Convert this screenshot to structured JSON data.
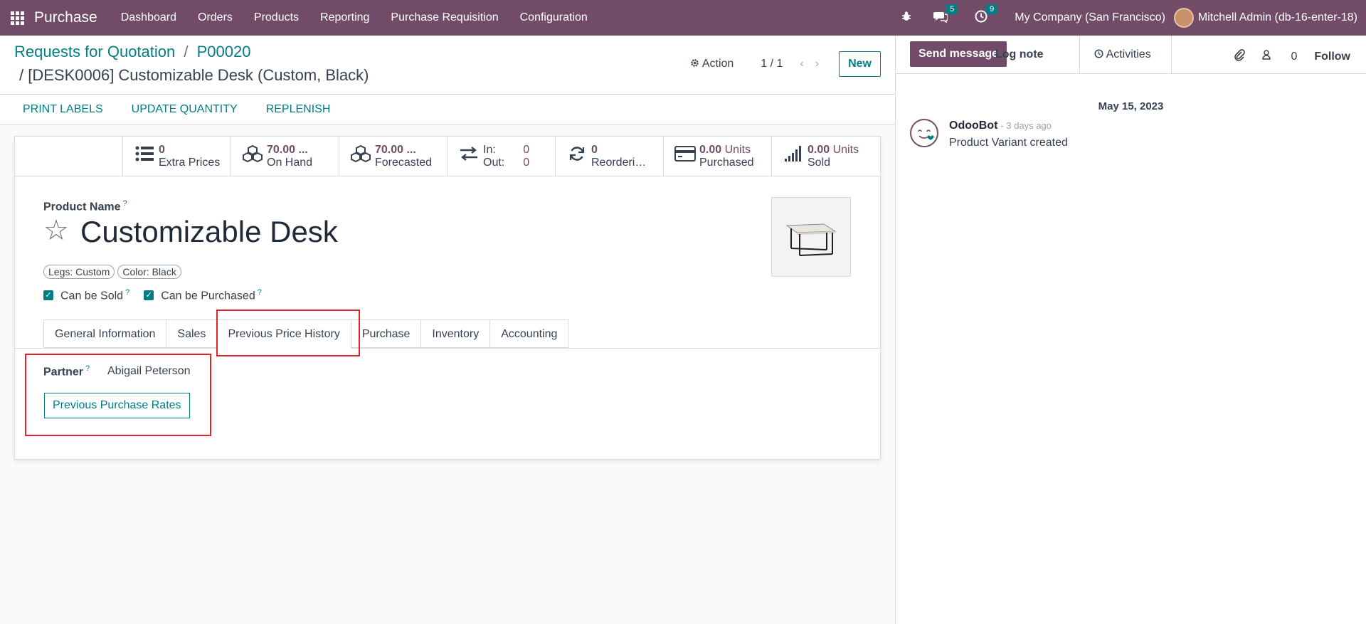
{
  "navbar": {
    "app_name": "Purchase",
    "menu": [
      "Dashboard",
      "Orders",
      "Products",
      "Reporting",
      "Purchase Requisition",
      "Configuration"
    ],
    "messages_count": "5",
    "activities_count": "9",
    "company": "My Company (San Francisco)",
    "user": "Mitchell Admin (db-16-enter-18)"
  },
  "breadcrumb": {
    "root": "Requests for Quotation",
    "separator": "/",
    "parent": "P00020",
    "current": "/ [DESK0006] Customizable Desk (Custom, Black)"
  },
  "control": {
    "action_label": "Action",
    "pager": "1 / 1",
    "new_label": "New"
  },
  "buttons": [
    "PRINT LABELS",
    "UPDATE QUANTITY",
    "REPLENISH"
  ],
  "stats": {
    "extra_prices": {
      "value": "0",
      "label": "Extra Prices"
    },
    "on_hand": {
      "value": "70.00 ...",
      "label": "On Hand"
    },
    "forecasted": {
      "value": "70.00 ...",
      "label": "Forecasted"
    },
    "in_label": "In:",
    "in_value": "0",
    "out_label": "Out:",
    "out_value": "0",
    "reordering": {
      "value": "0",
      "label": "Reorderi…"
    },
    "purchased": {
      "value": "0.00",
      "unit": "Units",
      "label": "Purchased"
    },
    "sold": {
      "value": "0.00",
      "unit": "Units",
      "label": "Sold"
    }
  },
  "product": {
    "name_label": "Product Name",
    "help": "?",
    "name": "Customizable Desk",
    "tags": [
      "Legs: Custom",
      "Color: Black"
    ],
    "can_be_sold": "Can be Sold",
    "can_be_purchased": "Can be Purchased"
  },
  "tabs": [
    "General Information",
    "Sales",
    "Previous Price History",
    "Purchase",
    "Inventory",
    "Accounting"
  ],
  "price_history": {
    "partner_label": "Partner",
    "partner_value": "Abigail Peterson",
    "button_label": "Previous Purchase Rates"
  },
  "chatter": {
    "send_message": "Send message",
    "log_note": "Log note",
    "activities": "Activities",
    "followers_count": "0",
    "follow": "Follow",
    "date": "May 15, 2023",
    "author": "OdooBot",
    "time": "- 3 days ago",
    "body": "Product Variant created"
  },
  "colors": {
    "brand": "#714b67",
    "accent": "#017e84",
    "highlight": "#e8202a"
  }
}
